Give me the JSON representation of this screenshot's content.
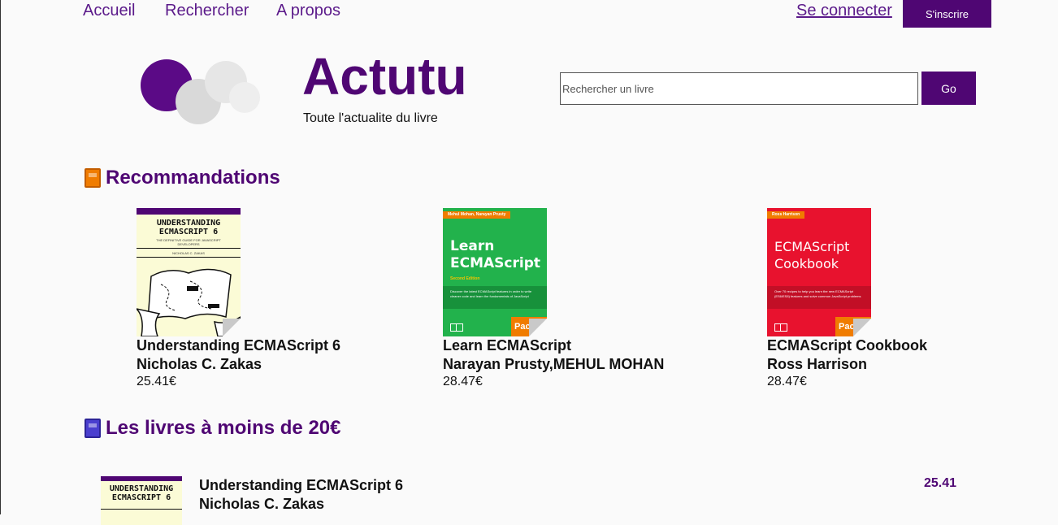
{
  "nav": {
    "items": [
      {
        "label": "Accueil"
      },
      {
        "label": "Rechercher"
      },
      {
        "label": "A propos"
      }
    ],
    "login_label": "Se connecter",
    "signup_label": "S'inscrire"
  },
  "brand": {
    "title": "Actutu",
    "tagline": "Toute l'actualite du livre"
  },
  "search": {
    "placeholder": "Rechercher un livre",
    "value": "",
    "button_label": "Go"
  },
  "colors": {
    "accent": "#4f0673",
    "link": "#5b1a8a"
  },
  "recommendations": {
    "heading": "Recommandations",
    "heading_icon": "orange-book-icon",
    "books": [
      {
        "title": "Understanding ECMAScript 6",
        "author": "Nicholas C. Zakas",
        "price": "25.41€",
        "cover": {
          "title_lines": [
            "UNDERSTANDING",
            "ECMASCRIPT 6"
          ],
          "subtitle": "THE DEFINITIVE GUIDE FOR JAVASCRIPT DEVELOPERS",
          "author": "NICHOLAS C. ZAKAS"
        }
      },
      {
        "title": "Learn ECMAScript",
        "author": "Narayan Prusty,MEHUL MOHAN",
        "price": "28.47€",
        "cover": {
          "authors": "Mehul Mohan, Narayan Prusty",
          "title_lines": [
            "Learn",
            "ECMAScript"
          ],
          "edition": "Second Edition",
          "blurb": "Discover the latest ECMAScript features in order to write cleaner code and learn the fundamentals of JavaScript",
          "publisher": "Pack"
        }
      },
      {
        "title": "ECMAScript Cookbook",
        "author": "Ross Harrison",
        "price": "28.47€",
        "cover": {
          "authors": "Ross Harrison",
          "title_lines": [
            "ECMAScript",
            "Cookbook"
          ],
          "blurb": "Over 70 recipes to help you learn the new ECMAScript (ES6/ES8) features and solve common JavaScript problems",
          "publisher": "Pack"
        }
      }
    ]
  },
  "cheap": {
    "heading": "Les livres à moins de 20€",
    "heading_icon": "blue-book-icon",
    "books": [
      {
        "title": "Understanding ECMAScript 6",
        "author": "Nicholas C. Zakas",
        "price": "25.41",
        "cover": {
          "title_lines": [
            "UNDERSTANDING",
            "ECMASCRIPT 6"
          ]
        }
      }
    ]
  }
}
